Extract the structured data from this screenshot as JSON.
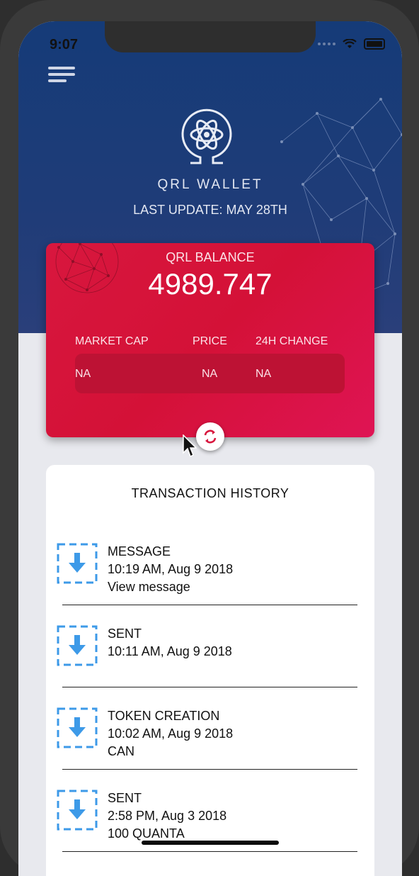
{
  "status_bar": {
    "time": "9:07"
  },
  "header": {
    "app_title": "QRL WALLET",
    "last_update": "LAST UPDATE: MAY 28TH",
    "menu_icon": "hamburger-menu-icon",
    "logo_icon": "qrl-atom-logo-icon"
  },
  "balance_card": {
    "label": "QRL BALANCE",
    "value": "4989.747",
    "stats": [
      {
        "label": "MARKET CAP",
        "value": "NA"
      },
      {
        "label": "PRICE",
        "value": "NA"
      },
      {
        "label": "24H CHANGE",
        "value": "NA"
      }
    ]
  },
  "history": {
    "title": "TRANSACTION HISTORY",
    "items": [
      {
        "type": "MESSAGE",
        "time": "10:19 AM, Aug 9 2018",
        "detail": "View message"
      },
      {
        "type": "SENT",
        "time": "10:11 AM, Aug 9 2018",
        "detail": ""
      },
      {
        "type": "TOKEN CREATION",
        "time": "10:02 AM, Aug 9 2018",
        "detail": "CAN"
      },
      {
        "type": "SENT",
        "time": "2:58 PM, Aug 3 2018",
        "detail": "100 QUANTA"
      }
    ]
  },
  "colors": {
    "hero": "#1f3c78",
    "card": "#d8173e",
    "icon_blue": "#3d9ae8",
    "background": "#e8e9ee"
  }
}
